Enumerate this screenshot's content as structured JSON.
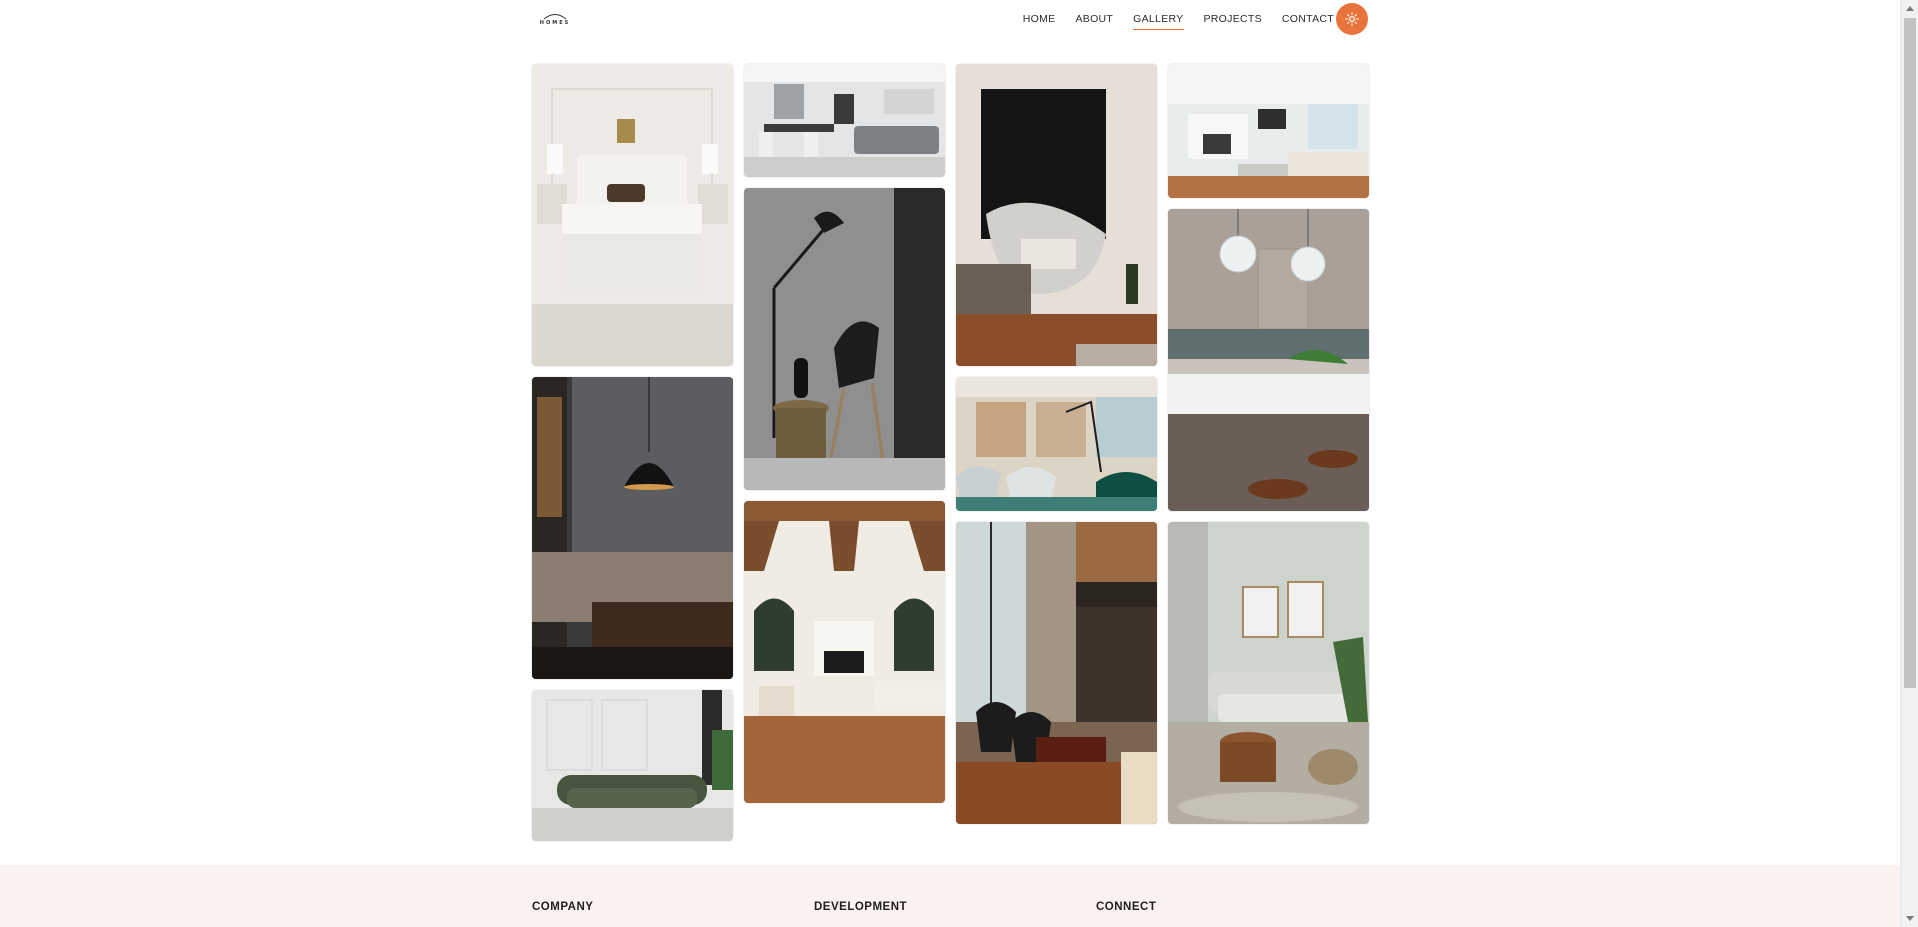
{
  "nav": {
    "logo_text": "HOMES",
    "items": [
      {
        "label": "HOME",
        "active": false
      },
      {
        "label": "ABOUT",
        "active": false
      },
      {
        "label": "GALLERY",
        "active": true
      },
      {
        "label": "PROJECTS",
        "active": false
      },
      {
        "label": "CONTACT",
        "active": false
      }
    ],
    "theme_toggle_icon": "sun-icon",
    "accent_color": "#e8743b"
  },
  "gallery": {
    "photos": [
      {
        "name": "bedroom-white-bed",
        "subject": "white bedroom with leopard pillow"
      },
      {
        "name": "open-plan-living-dining",
        "subject": "grey sofa open-plan living room"
      },
      {
        "name": "black-art-lounge-chair",
        "subject": "round chair under black painting"
      },
      {
        "name": "bright-living-fireplace",
        "subject": "white living room with fireplace"
      },
      {
        "name": "black-chair-floor-lamp",
        "subject": "black chair and floor lamp"
      },
      {
        "name": "kitchen-pendant-island",
        "subject": "kitchen island with glass pendants"
      },
      {
        "name": "dark-lounge-pendant",
        "subject": "dark lounge with pendant lamp"
      },
      {
        "name": "office-teal-chairs",
        "subject": "office with teal chairs"
      },
      {
        "name": "beamed-living-room",
        "subject": "living room with wooden beams"
      },
      {
        "name": "loft-leather-chairs",
        "subject": "loft with leather chairs"
      },
      {
        "name": "sage-living-room",
        "subject": "sage living room with pouf"
      },
      {
        "name": "green-velvet-sofa",
        "subject": "green velvet sofa"
      }
    ]
  },
  "footer": {
    "columns": [
      "COMPANY",
      "DEVELOPMENT",
      "CONNECT"
    ],
    "background": "#fbf1f1"
  }
}
